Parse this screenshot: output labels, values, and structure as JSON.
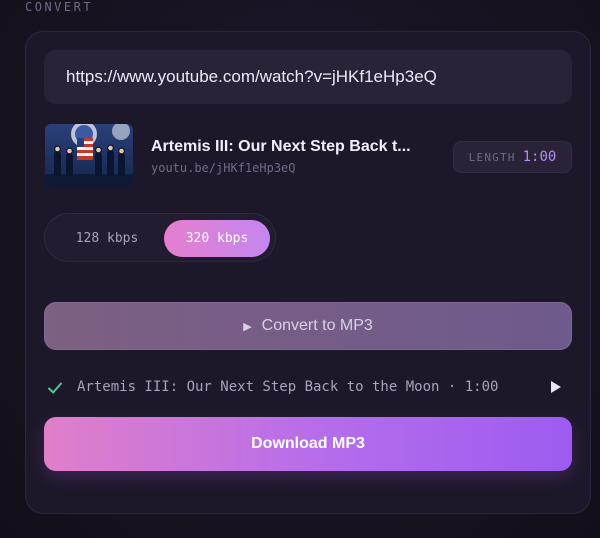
{
  "section": {
    "label": "CONVERT"
  },
  "url_input": {
    "value": "https://www.youtube.com/watch?v=jHKf1eHp3eQ"
  },
  "video": {
    "title": "Artemis III: Our Next Step Back t...",
    "link": "youtu.be/jHKf1eHp3eQ",
    "length_label": "LENGTH",
    "length_value": "1:00"
  },
  "bitrate": {
    "options": [
      "128 kbps",
      "320 kbps"
    ],
    "selected": "320 kbps"
  },
  "convert": {
    "label": "Convert to MP3",
    "icon": "play-icon"
  },
  "result": {
    "text": "Artemis III: Our Next Step Back to the Moon · 1:00",
    "status_icon": "check-icon",
    "play_icon": "play-icon"
  },
  "download": {
    "label": "Download MP3"
  },
  "colors": {
    "background": "#16121f",
    "card": "#1d1829",
    "accent_pink": "#e07fca",
    "accent_purple": "#9d5cf0",
    "length_value": "#b88aff",
    "check": "#4ec98a"
  }
}
